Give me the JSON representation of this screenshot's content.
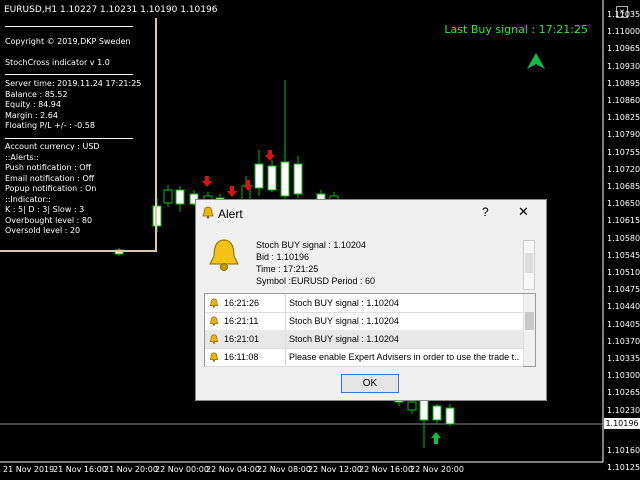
{
  "header": {
    "symbol_line": "EURUSD,H1  1.10227 1.10231 1.10190 1.10196",
    "last_signal": "Last Buy signal : 17:21:25",
    "close_glyph": "×"
  },
  "info_panel": {
    "copyright": "Copyright © 2019,DKP Sweden",
    "indicator": "StochCross indicator v 1.0",
    "server_time": "Server time:  2019.11.24 17:21:25",
    "balance": "Balance :  85.52",
    "equity": "Equity :   84.94",
    "margin": "Margin :   2.64",
    "floating": "Floating P/L +/- :     -0.58",
    "account_currency": "Account currency :   USD",
    "alerts_header": "::Alerts::",
    "push": "Push notification :     Off",
    "email": "Email notification :     Off",
    "popup": "Popup notification :    On",
    "indicator_header": "::Indicator::",
    "kds": "K : 5| D : 3| Slow : 3",
    "overbought": "Overbought level : 80",
    "oversold": "Oversold level : 20"
  },
  "price_axis": [
    "1.11035",
    "1.11000",
    "1.10965",
    "1.10930",
    "1.10895",
    "1.10860",
    "1.10825",
    "1.10790",
    "1.10755",
    "1.10720",
    "1.10685",
    "1.10650",
    "1.10615",
    "1.10580",
    "1.10545",
    "1.10510",
    "1.10475",
    "1.10440",
    "1.10405",
    "1.10370",
    "1.10335",
    "1.10300",
    "1.10265",
    "1.10230",
    "1.10196",
    "1.10160",
    "1.10125"
  ],
  "current_price": "1.10196",
  "time_axis": [
    "21 Nov 2019",
    "21 Nov 16:00",
    "21 Nov 20:00",
    "22 Nov 00:00",
    "22 Nov 04:00",
    "22 Nov 08:00",
    "22 Nov 12:00",
    "22 Nov 16:00",
    "22 Nov 20:00"
  ],
  "alert": {
    "title": "Alert",
    "help": "?",
    "close": "✕",
    "message": [
      "Stoch BUY signal : 1.10204",
      "Bid : 1.10196",
      "Time : 17:21:25",
      "Symbol :EURUSD Period : 60"
    ],
    "log": [
      {
        "time": "16:21:26",
        "msg": "Stoch BUY signal : 1.10204"
      },
      {
        "time": "16:21:11",
        "msg": "Stoch BUY signal : 1.10204"
      },
      {
        "time": "16:21:01",
        "msg": "Stoch BUY signal : 1.10204"
      },
      {
        "time": "16:11:08",
        "msg": "Please enable Expert Advisers in order to use the trade t..."
      }
    ],
    "ok": "OK"
  },
  "colors": {
    "bull_candle": "#ffffff",
    "bear_candle": "#000000",
    "wick": "#00c000",
    "sell_arrow": "#e01010",
    "buy_arrow": "#10c040",
    "signal_text": "#2ee82e"
  }
}
